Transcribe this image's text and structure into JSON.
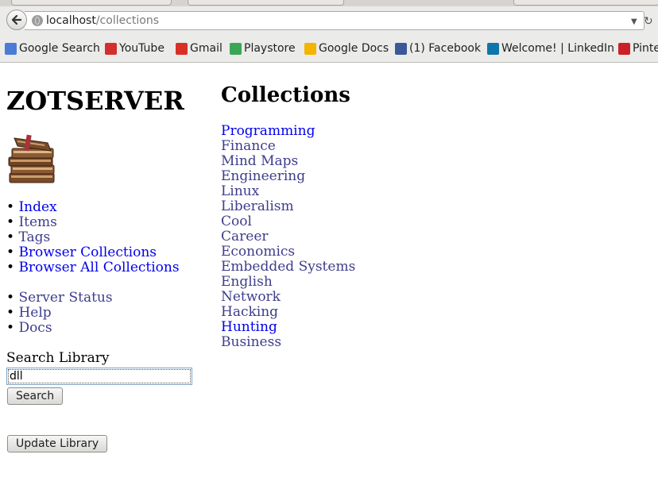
{
  "browser": {
    "url_host": "localhost",
    "url_path": "/collections",
    "bookmarks": [
      {
        "label": "Google Search",
        "icon": "google-icon",
        "color": "#4a7bd6"
      },
      {
        "label": "YouTube",
        "icon": "youtube-icon",
        "color": "#d32f2f"
      },
      {
        "label": "Gmail",
        "icon": "gmail-icon",
        "color": "#d93025"
      },
      {
        "label": "Playstore",
        "icon": "playstore-icon",
        "color": "#3aa757"
      },
      {
        "label": "Google Docs",
        "icon": "google-drive-icon",
        "color": "#f4b400"
      },
      {
        "label": "(1) Facebook",
        "icon": "facebook-icon",
        "color": "#3b5998"
      },
      {
        "label": "Welcome! | LinkedIn",
        "icon": "linkedin-icon",
        "color": "#0e76a8"
      },
      {
        "label": "Pinte",
        "icon": "pinterest-icon",
        "color": "#cb2027"
      }
    ]
  },
  "site": {
    "title": "ZOTSERVER"
  },
  "nav": {
    "bullet": "•",
    "primary": [
      {
        "label": "Index",
        "visited": false
      },
      {
        "label": "Items",
        "visited": true
      },
      {
        "label": "Tags",
        "visited": true
      },
      {
        "label": "Browser Collections",
        "visited": false
      },
      {
        "label": "Browser All Collections",
        "visited": false
      }
    ],
    "secondary": [
      {
        "label": "Server Status",
        "visited": true
      },
      {
        "label": "Help",
        "visited": true
      },
      {
        "label": "Docs",
        "visited": true
      }
    ]
  },
  "search": {
    "label": "Search Library",
    "value": "dll",
    "button_label": "Search"
  },
  "update_button_label": "Update Library",
  "collections": {
    "title": "Collections",
    "items": [
      {
        "label": "Programming",
        "visited": false
      },
      {
        "label": "Finance",
        "visited": true
      },
      {
        "label": "Mind Maps",
        "visited": true
      },
      {
        "label": "Engineering",
        "visited": true
      },
      {
        "label": "Linux",
        "visited": true
      },
      {
        "label": "Liberalism",
        "visited": true
      },
      {
        "label": "Cool",
        "visited": true
      },
      {
        "label": "Career",
        "visited": true
      },
      {
        "label": "Economics",
        "visited": true
      },
      {
        "label": "Embedded Systems",
        "visited": true
      },
      {
        "label": "English",
        "visited": true
      },
      {
        "label": "Network",
        "visited": true
      },
      {
        "label": "Hacking",
        "visited": true
      },
      {
        "label": "Hunting",
        "visited": false
      },
      {
        "label": "Business",
        "visited": true
      }
    ]
  },
  "colors": {
    "link": "#0000ee",
    "visited_link": "#3d3d8c"
  }
}
